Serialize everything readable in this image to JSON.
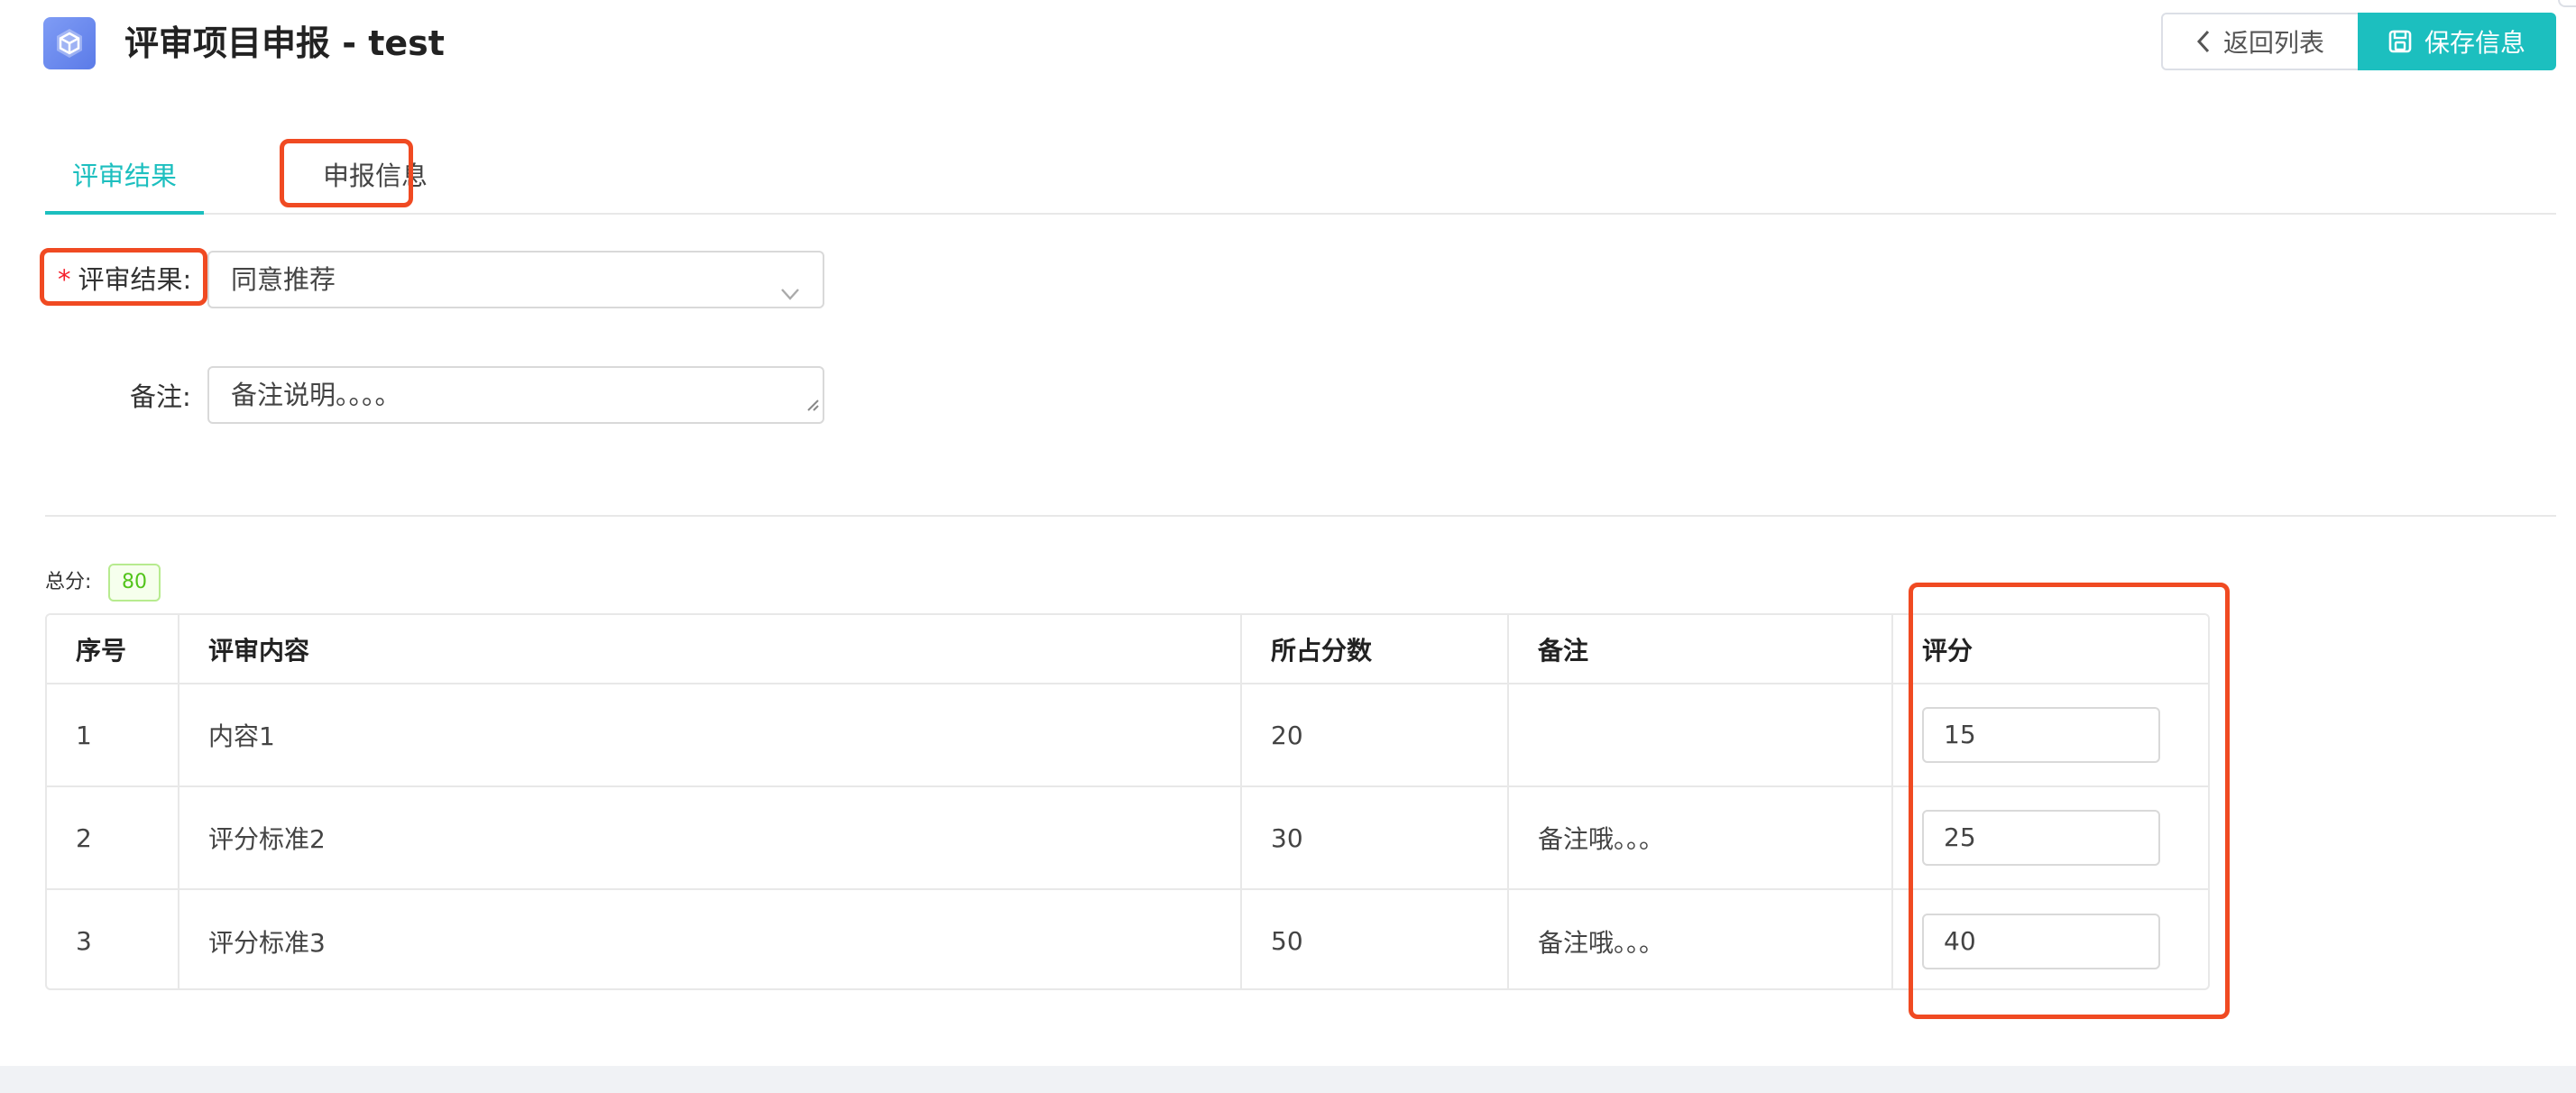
{
  "header": {
    "title": "评审项目申报 - test",
    "back_label": "返回列表",
    "save_label": "保存信息"
  },
  "tabs": [
    {
      "label": "评审结果",
      "active": true
    },
    {
      "label": "申报信息",
      "active": false
    }
  ],
  "form": {
    "result_label": "评审结果",
    "result_value": "同意推荐",
    "remark_label": "备注",
    "remark_value": "备注说明。。。。"
  },
  "total": {
    "label": "总分:",
    "value": "80"
  },
  "table": {
    "columns": [
      "序号",
      "评审内容",
      "所占分数",
      "备注",
      "评分"
    ],
    "rows": [
      {
        "index": "1",
        "content": "内容1",
        "weight": "20",
        "remark": "",
        "score": "15"
      },
      {
        "index": "2",
        "content": "评分标准2",
        "weight": "30",
        "remark": "备注哦。。。",
        "score": "25"
      },
      {
        "index": "3",
        "content": "评分标准3",
        "weight": "50",
        "remark": "备注哦。。。",
        "score": "40"
      }
    ]
  },
  "colors": {
    "accent": "#1cbfbf",
    "highlight": "#f04a22",
    "success": "#52c41a",
    "required": "#f5222d"
  }
}
